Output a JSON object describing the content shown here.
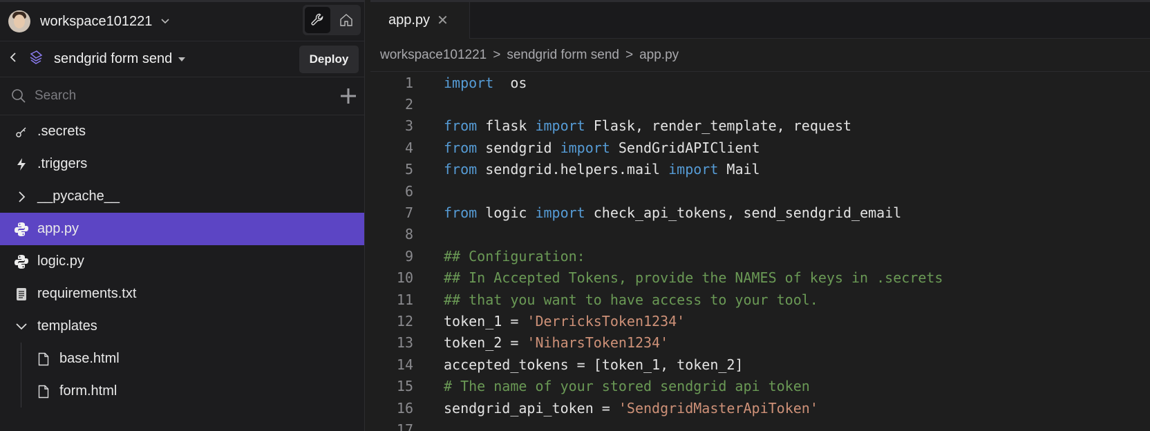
{
  "workspace": {
    "name": "workspace101221"
  },
  "project": {
    "name": "sendgrid form send",
    "deploy_label": "Deploy"
  },
  "search": {
    "placeholder": "Search"
  },
  "tree": {
    "items": [
      {
        "label": ".secrets",
        "icon": "key-icon"
      },
      {
        "label": ".triggers",
        "icon": "lightning-icon"
      },
      {
        "label": "__pycache__",
        "icon": "chevron-right-icon"
      },
      {
        "label": "app.py",
        "icon": "python-icon",
        "selected": true
      },
      {
        "label": "logic.py",
        "icon": "python-icon"
      },
      {
        "label": "requirements.txt",
        "icon": "text-file-icon"
      },
      {
        "label": "templates",
        "icon": "chevron-down-icon"
      },
      {
        "label": "base.html",
        "icon": "file-icon"
      },
      {
        "label": "form.html",
        "icon": "file-icon"
      }
    ]
  },
  "tab": {
    "label": "app.py",
    "close": "✕"
  },
  "breadcrumb": {
    "workspace": "workspace101221",
    "project": "sendgrid form send",
    "file": "app.py",
    "sep": ">"
  },
  "code": {
    "lines": [
      {
        "n": "1",
        "tokens": [
          [
            "kw",
            "import"
          ],
          [
            "",
            "  os"
          ]
        ]
      },
      {
        "n": "2",
        "tokens": []
      },
      {
        "n": "3",
        "tokens": [
          [
            "kw",
            "from"
          ],
          [
            "",
            " flask "
          ],
          [
            "kw",
            "import"
          ],
          [
            "",
            " Flask, render_template, request"
          ]
        ]
      },
      {
        "n": "4",
        "tokens": [
          [
            "kw",
            "from"
          ],
          [
            "",
            " sendgrid "
          ],
          [
            "kw",
            "import"
          ],
          [
            "",
            " SendGridAPIClient"
          ]
        ]
      },
      {
        "n": "5",
        "tokens": [
          [
            "kw",
            "from"
          ],
          [
            "",
            " sendgrid.helpers.mail "
          ],
          [
            "kw",
            "import"
          ],
          [
            "",
            " Mail"
          ]
        ]
      },
      {
        "n": "6",
        "tokens": []
      },
      {
        "n": "7",
        "tokens": [
          [
            "kw",
            "from"
          ],
          [
            "",
            " logic "
          ],
          [
            "kw",
            "import"
          ],
          [
            "",
            " check_api_tokens, send_sendgrid_email"
          ]
        ]
      },
      {
        "n": "8",
        "tokens": []
      },
      {
        "n": "9",
        "tokens": [
          [
            "cm",
            "## Configuration:"
          ]
        ]
      },
      {
        "n": "10",
        "tokens": [
          [
            "cm",
            "## In Accepted Tokens, provide the NAMES of keys in .secrets"
          ]
        ]
      },
      {
        "n": "11",
        "tokens": [
          [
            "cm",
            "## that you want to have access to your tool."
          ]
        ]
      },
      {
        "n": "12",
        "tokens": [
          [
            "",
            "token_1 = "
          ],
          [
            "st",
            "'DerricksToken1234'"
          ]
        ]
      },
      {
        "n": "13",
        "tokens": [
          [
            "",
            "token_2 = "
          ],
          [
            "st",
            "'NiharsToken1234'"
          ]
        ]
      },
      {
        "n": "14",
        "tokens": [
          [
            "",
            "accepted_tokens = [token_1, token_2]"
          ]
        ]
      },
      {
        "n": "15",
        "tokens": [
          [
            "cm",
            "# The name of your stored sendgrid api token"
          ]
        ]
      },
      {
        "n": "16",
        "tokens": [
          [
            "",
            "sendgrid_api_token = "
          ],
          [
            "st",
            "'SendgridMasterApiToken'"
          ]
        ]
      },
      {
        "n": "17",
        "tokens": []
      }
    ]
  },
  "colors": {
    "selected": "#5c45c4",
    "keyword": "#569cd6",
    "comment": "#6a9955",
    "string": "#ce9178"
  }
}
